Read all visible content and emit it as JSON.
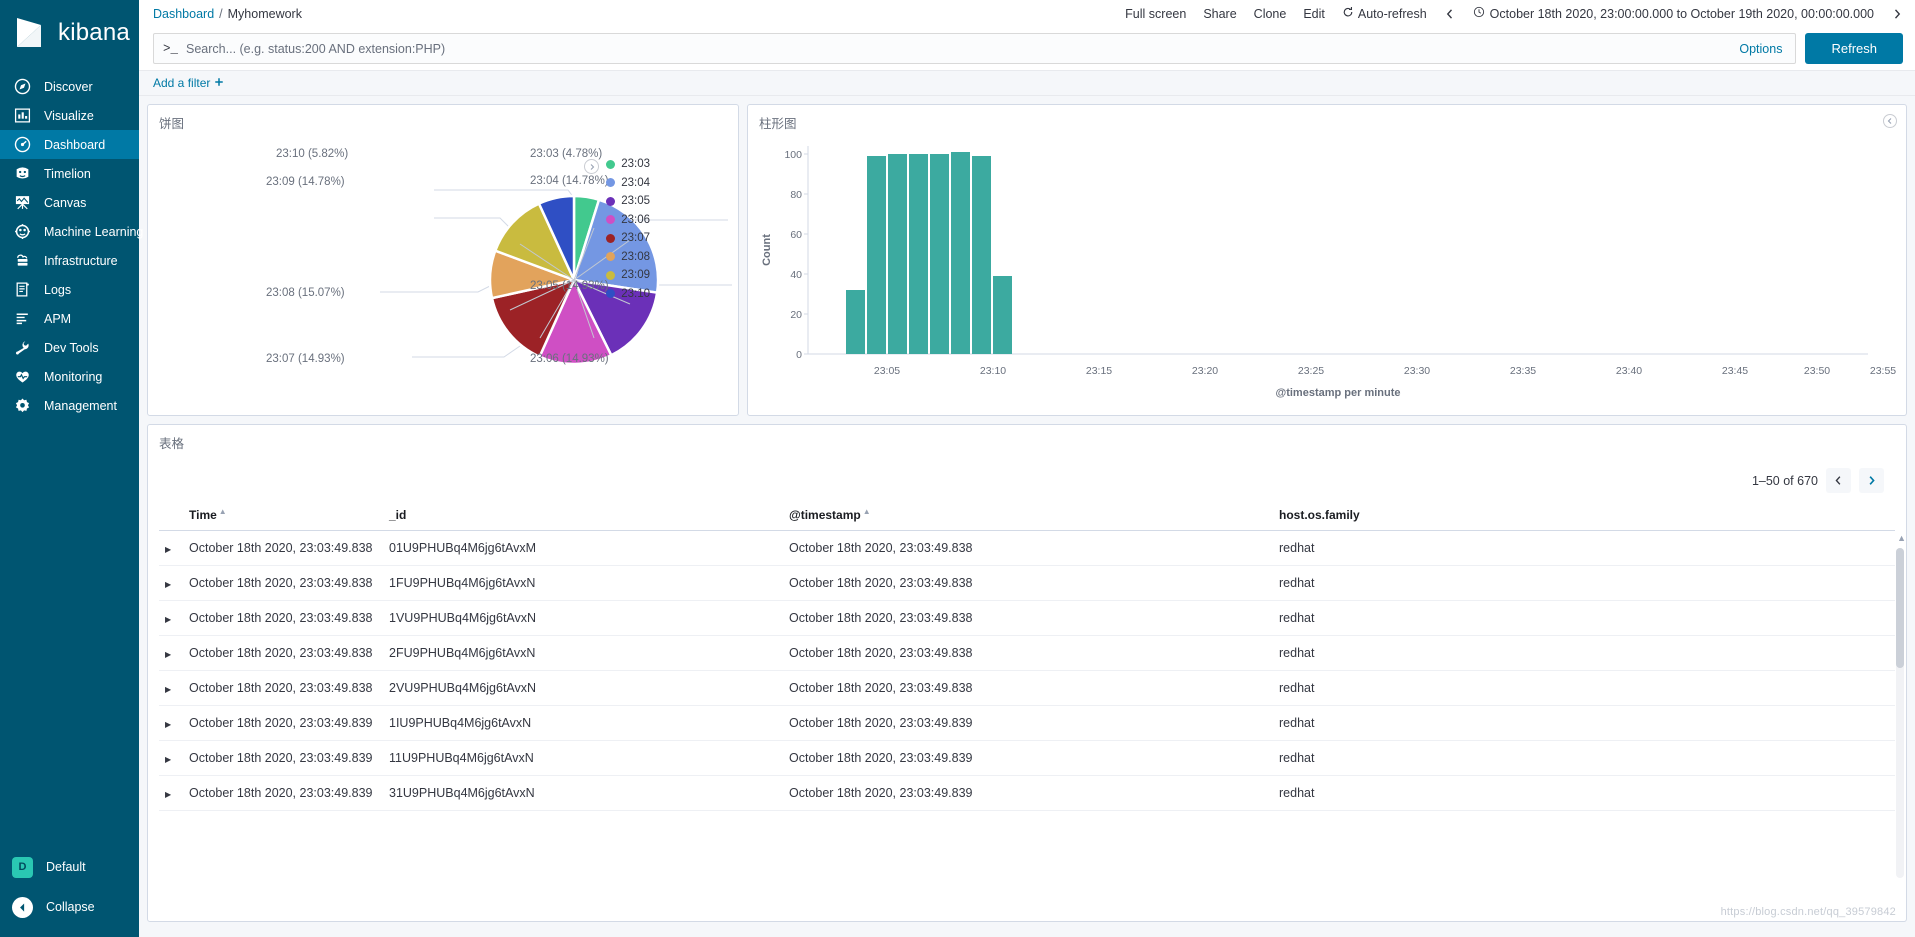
{
  "brand": {
    "name": "kibana",
    "logo_icon": "kibana-logo"
  },
  "sidebar": {
    "items": [
      {
        "label": "Discover",
        "icon": "discover-icon",
        "active": false
      },
      {
        "label": "Visualize",
        "icon": "visualize-icon",
        "active": false
      },
      {
        "label": "Dashboard",
        "icon": "dashboard-icon",
        "active": true
      },
      {
        "label": "Timelion",
        "icon": "timelion-icon",
        "active": false
      },
      {
        "label": "Canvas",
        "icon": "canvas-icon",
        "active": false
      },
      {
        "label": "Machine Learning",
        "icon": "machine-learning-icon",
        "active": false
      },
      {
        "label": "Infrastructure",
        "icon": "infrastructure-icon",
        "active": false
      },
      {
        "label": "Logs",
        "icon": "logs-icon",
        "active": false
      },
      {
        "label": "APM",
        "icon": "apm-icon",
        "active": false
      },
      {
        "label": "Dev Tools",
        "icon": "dev-tools-icon",
        "active": false
      },
      {
        "label": "Monitoring",
        "icon": "monitoring-icon",
        "active": false
      },
      {
        "label": "Management",
        "icon": "management-icon",
        "active": false
      }
    ],
    "space": {
      "initial": "D",
      "label": "Default"
    },
    "collapse": {
      "label": "Collapse",
      "icon": "collapse-arrow-icon"
    }
  },
  "breadcrumb": {
    "root": "Dashboard",
    "separator": "/",
    "current": "Myhomework"
  },
  "header": {
    "full_screen": "Full screen",
    "share": "Share",
    "clone": "Clone",
    "edit": "Edit",
    "auto_refresh": "Auto-refresh",
    "date_range": "October 18th 2020, 23:00:00.000 to October 19th 2020, 00:00:00.000"
  },
  "search": {
    "prompt": ">_",
    "placeholder": "Search... (e.g. status:200 AND extension:PHP)",
    "value": "",
    "options_label": "Options",
    "refresh_label": "Refresh"
  },
  "filters": {
    "add_label": "Add a filter",
    "add_icon": "plus-icon"
  },
  "panels": {
    "pie_title": "饼图",
    "bar_title": "柱形图",
    "table_title": "表格"
  },
  "table": {
    "pagination": "1–50 of 670",
    "columns": [
      {
        "label": "Time",
        "sorted": true
      },
      {
        "label": "_id",
        "sorted": false
      },
      {
        "label": "@timestamp",
        "sorted": true
      },
      {
        "label": "host.os.family",
        "sorted": false
      }
    ],
    "rows": [
      {
        "time": "October 18th 2020, 23:03:49.838",
        "id": "01U9PHUBq4M6jg6tAvxM",
        "timestamp": "October 18th 2020, 23:03:49.838",
        "host": "redhat"
      },
      {
        "time": "October 18th 2020, 23:03:49.838",
        "id": "1FU9PHUBq4M6jg6tAvxN",
        "timestamp": "October 18th 2020, 23:03:49.838",
        "host": "redhat"
      },
      {
        "time": "October 18th 2020, 23:03:49.838",
        "id": "1VU9PHUBq4M6jg6tAvxN",
        "timestamp": "October 18th 2020, 23:03:49.838",
        "host": "redhat"
      },
      {
        "time": "October 18th 2020, 23:03:49.838",
        "id": "2FU9PHUBq4M6jg6tAvxN",
        "timestamp": "October 18th 2020, 23:03:49.838",
        "host": "redhat"
      },
      {
        "time": "October 18th 2020, 23:03:49.838",
        "id": "2VU9PHUBq4M6jg6tAvxN",
        "timestamp": "October 18th 2020, 23:03:49.838",
        "host": "redhat"
      },
      {
        "time": "October 18th 2020, 23:03:49.839",
        "id": "1IU9PHUBq4M6jg6tAvxN",
        "timestamp": "October 18th 2020, 23:03:49.839",
        "host": "redhat"
      },
      {
        "time": "October 18th 2020, 23:03:49.839",
        "id": "11U9PHUBq4M6jg6tAvxN",
        "timestamp": "October 18th 2020, 23:03:49.839",
        "host": "redhat"
      },
      {
        "time": "October 18th 2020, 23:03:49.839",
        "id": "31U9PHUBq4M6jg6tAvxN",
        "timestamp": "October 18th 2020, 23:03:49.839",
        "host": "redhat"
      }
    ]
  },
  "chart_data": [
    {
      "type": "pie",
      "title": "饼图",
      "legend_position": "right",
      "labels": [
        "23:03",
        "23:04",
        "23:05",
        "23:06",
        "23:07",
        "23:08",
        "23:09",
        "23:10"
      ],
      "values": [
        4.78,
        14.78,
        14.93,
        14.93,
        14.93,
        15.07,
        14.78,
        5.82
      ],
      "unit": "%",
      "colors": [
        "#42c98e",
        "#7497e3",
        "#6b30b8",
        "#cf4fc4",
        "#9c2226",
        "#e2a35c",
        "#c9bb3f",
        "#2f4fc4"
      ],
      "slice_labels": [
        "23:03 (4.78%)",
        "23:04 (14.78%)",
        "23:05 (14.93%)",
        "23:06 (14.93%)",
        "23:07 (14.93%)",
        "23:08 (15.07%)",
        "23:09 (14.78%)",
        "23:10 (5.82%)"
      ]
    },
    {
      "type": "bar",
      "title": "柱形图",
      "xlabel": "@timestamp per minute",
      "ylabel": "Count",
      "ylim": [
        0,
        105
      ],
      "yticks": [
        0,
        20,
        40,
        60,
        80,
        100
      ],
      "xticks": [
        "23:05",
        "23:10",
        "23:15",
        "23:20",
        "23:25",
        "23:30",
        "23:35",
        "23:40",
        "23:45",
        "23:50",
        "23:55"
      ],
      "categories": [
        "23:03",
        "23:04",
        "23:05",
        "23:06",
        "23:07",
        "23:08",
        "23:09",
        "23:10"
      ],
      "values": [
        32,
        99,
        100,
        100,
        100,
        101,
        99,
        39
      ],
      "color": "#3caaa0",
      "grid": false
    }
  ],
  "watermark": "https://blog.csdn.net/qq_39579842"
}
